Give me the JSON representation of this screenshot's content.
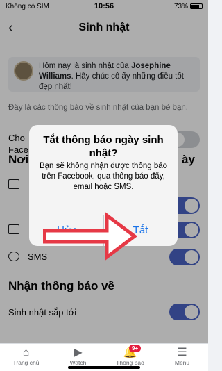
{
  "status_bar": {
    "carrier": "Không có SIM",
    "time": "10:56",
    "battery": "73%"
  },
  "header": {
    "title": "Sinh nhật",
    "back_icon": "chevron-left-icon"
  },
  "birthday_card": {
    "text_before": "Hôm nay là sinh nhật của ",
    "name": "Josephine Williams",
    "text_after": ". Hãy chúc cô ấy những điều tốt đẹp nhất!"
  },
  "description": "Đây là các thông báo về sinh nhật của bạn bè bạn.",
  "push_row": {
    "label_line1": "Cho",
    "label_line2": "Face"
  },
  "section_receive": {
    "title_left": "Nơi",
    "title_right": "ày"
  },
  "options": [
    {
      "name": "push",
      "icon": "phone-icon",
      "enabled": true
    },
    {
      "name": "email",
      "icon": "mail-icon",
      "enabled": true
    },
    {
      "name": "sms",
      "label": "SMS",
      "icon": "sms-icon",
      "enabled": true
    }
  ],
  "section_notify": {
    "title": "Nhận thông báo về"
  },
  "upcoming": {
    "label": "Sinh nhật sắp tới",
    "enabled": true
  },
  "dialog": {
    "title": "Tắt thông báo ngày sinh nhật?",
    "message": "Bạn sẽ không nhận được thông báo trên Facebook, qua thông báo đẩy, email hoặc SMS.",
    "cancel_label": "Hủy",
    "confirm_label": "Tắt"
  },
  "tabbar": {
    "tabs": [
      {
        "label": "Trang chủ",
        "icon": "home-icon"
      },
      {
        "label": "Watch",
        "icon": "watch-icon"
      },
      {
        "label": "Thông báo",
        "icon": "bell-icon",
        "badge": "9+"
      },
      {
        "label": "Menu",
        "icon": "menu-icon"
      }
    ]
  },
  "colors": {
    "accent": "#4a63c4",
    "dialog_button": "#1a73e8",
    "arrow": "#e63946",
    "badge": "#e41e3f"
  }
}
